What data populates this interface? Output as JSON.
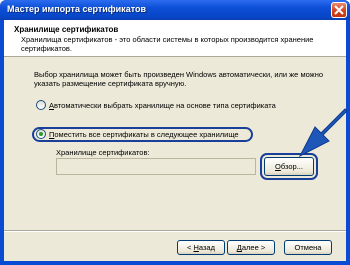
{
  "window": {
    "title": "Мастер импорта сертификатов"
  },
  "header": {
    "title": "Хранилище сертификатов",
    "description": "Хранилища сертификатов - это области системы в которых производится хранение сертификатов."
  },
  "body": {
    "intro": "Выбор хранилища может быть произведен Windows автоматически, или же можно указать размещение сертификата вручную.",
    "option_auto": {
      "label_pre": "",
      "label_accel": "А",
      "label_post": "втоматически выбрать хранилище на основе типа сертификата",
      "selected": false
    },
    "option_manual": {
      "label_pre": "",
      "label_accel": "П",
      "label_post": "оместить все сертификаты в следующее хранилище",
      "selected": true
    },
    "store_label": "Хранилище сертификатов:",
    "store_value": "",
    "browse_pre": "",
    "browse_accel": "О",
    "browse_post": "бзор..."
  },
  "footer": {
    "back_pre": "< ",
    "back_accel": "Н",
    "back_post": "азад",
    "next_pre": "",
    "next_accel": "Д",
    "next_post": "алее >",
    "cancel": "Отмена"
  },
  "colors": {
    "titlebar": "#0c4fd6",
    "highlight": "#1a3f9a",
    "arrow": "#1e57b8",
    "dialog_bg": "#ece9d8"
  },
  "icons": {
    "close": "close-icon",
    "pointer": "arrow-pointer-icon"
  }
}
